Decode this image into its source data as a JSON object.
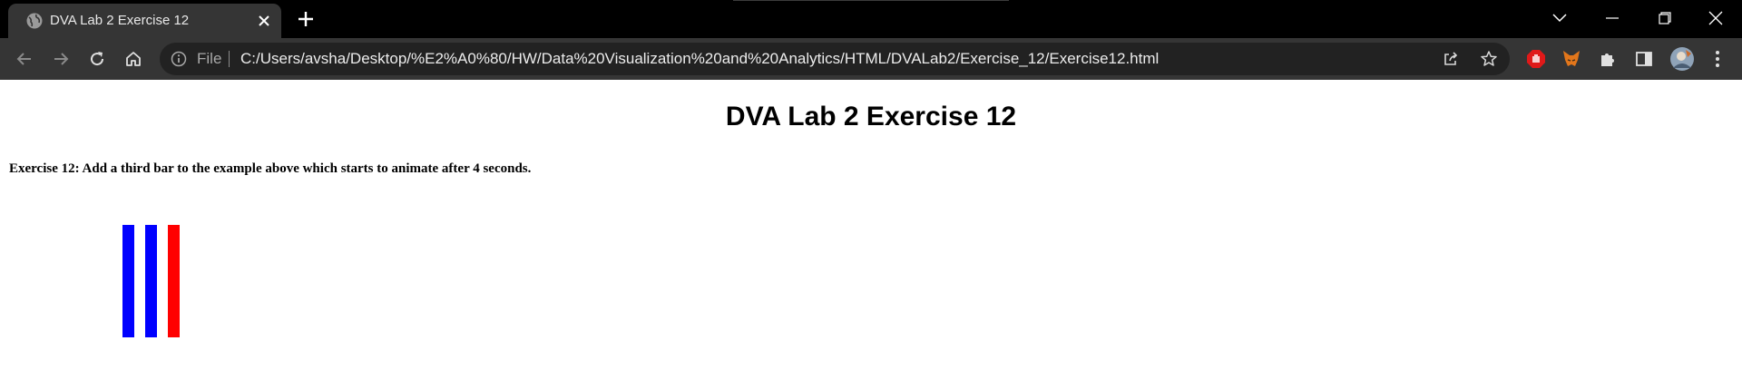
{
  "browser": {
    "tab": {
      "title": "DVA Lab 2 Exercise 12",
      "favicon": "globe-icon"
    },
    "omnibox": {
      "scheme_label": "File",
      "url": "C:/Users/avsha/Desktop/%E2%A0%80/HW/Data%20Visualization%20and%20Analytics/HTML/DVALab2/Exercise_12/Exercise12.html"
    },
    "colors": {
      "frame": "#000000",
      "tab": "#353535",
      "toolbar": "#353535",
      "omnibox": "#222222"
    }
  },
  "page": {
    "heading": "DVA Lab 2 Exercise 12",
    "exercise_text": "Exercise 12: Add a third bar to the example above which starts to animate after 4 seconds.",
    "bars": [
      {
        "color": "#0000ff"
      },
      {
        "color": "#0000ff"
      },
      {
        "color": "#ff0000"
      }
    ]
  }
}
